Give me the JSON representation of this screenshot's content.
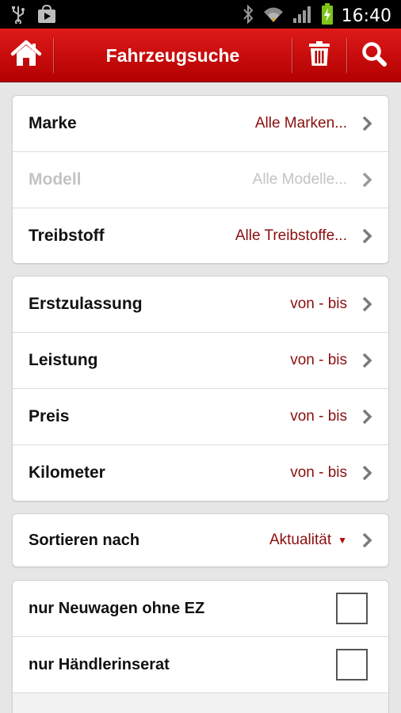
{
  "status_bar": {
    "time": "16:40",
    "icons": [
      "usb-icon",
      "store-icon",
      "bluetooth-icon",
      "wifi-icon",
      "signal-icon",
      "battery-charging-icon"
    ]
  },
  "app_bar": {
    "title": "Fahrzeugsuche",
    "buttons": [
      "home-icon",
      "trash-icon",
      "search-icon"
    ]
  },
  "colors": {
    "accent": "#c30000",
    "value_text": "#8b0f0f",
    "disabled_text": "#c3c3c3"
  },
  "group1": [
    {
      "label": "Marke",
      "value": "Alle Marken..."
    },
    {
      "label": "Modell",
      "value": "Alle Modelle...",
      "disabled": true
    },
    {
      "label": "Treibstoff",
      "value": "Alle Treibstoffe..."
    }
  ],
  "group2": [
    {
      "label": "Erstzulassung",
      "value": "von - bis"
    },
    {
      "label": "Leistung",
      "value": "von - bis"
    },
    {
      "label": "Preis",
      "value": "von - bis"
    },
    {
      "label": "Kilometer",
      "value": "von - bis"
    }
  ],
  "sort": {
    "label": "Sortieren nach",
    "value": "Aktualität"
  },
  "filters": [
    {
      "label": "nur Neuwagen ohne EZ",
      "checked": false
    },
    {
      "label": "nur Händlerinserat",
      "checked": false
    }
  ]
}
